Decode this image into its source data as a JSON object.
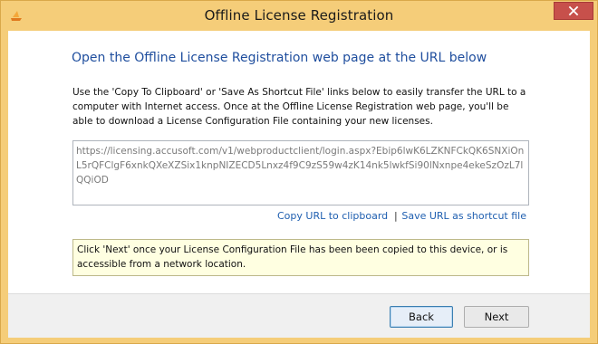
{
  "window": {
    "title": "Offline License Registration",
    "app_icon": "app-logo-icon",
    "close_icon": "close-icon"
  },
  "content": {
    "heading": "Open the Offline License Registration web page at the URL below",
    "description": "Use the 'Copy To Clipboard' or 'Save As Shortcut File' links below to easily transfer the URL to a computer with Internet access. Once at the Offline License Registration web page, you'll be able to download a License Configuration File containing your new licenses.",
    "url": "https://licensing.accusoft.com/v1/webproductclient/login.aspx?Ebip6lwK6LZKNFCkQK6SNXiOnL5rQFClgF6xnkQXeXZSix1knpNIZECD5Lnxz4f9C9zS59w4zK14nk5lwkfSi90lNxnpe4ekeSzOzL7lQQiOD",
    "copy_link": "Copy URL to clipboard",
    "separator": "|",
    "save_link": "Save URL as shortcut file",
    "note": "Click 'Next' once your License Configuration File has been been copied to this device, or is accessible from a network location."
  },
  "footer": {
    "back_label": "Back",
    "next_label": "Next"
  },
  "colors": {
    "frame": "#f5cd79",
    "heading": "#1f4e9e",
    "link": "#1f5fb0",
    "close_button": "#c7504b",
    "note_background": "#ffffe1"
  }
}
